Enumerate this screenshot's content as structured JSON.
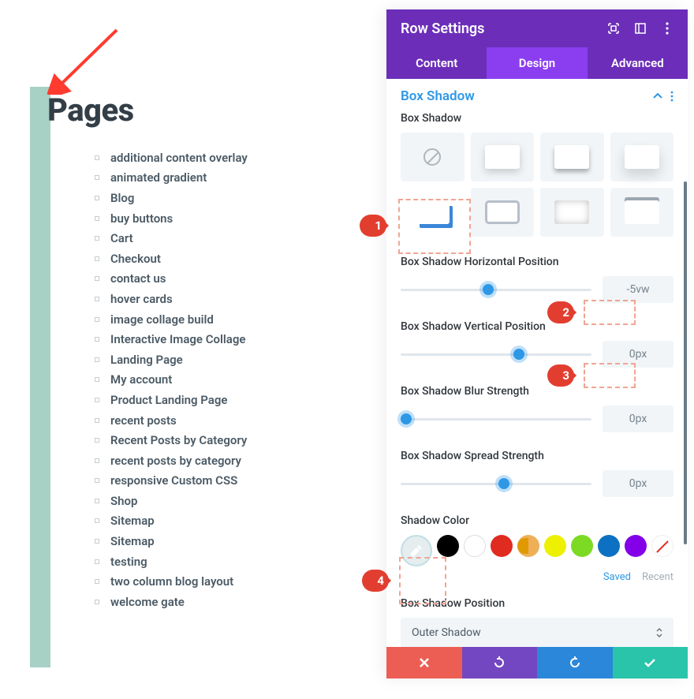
{
  "pages": {
    "heading": "Pages",
    "items": [
      "additional content overlay",
      "animated gradient",
      "Blog",
      "buy buttons",
      "Cart",
      "Checkout",
      "contact us",
      "hover cards",
      "image collage build",
      "Interactive Image Collage",
      "Landing Page",
      "My account",
      "Product Landing Page",
      "recent posts",
      "Recent Posts by Category",
      "recent posts by category",
      "responsive Custom CSS",
      "Shop",
      "Sitemap",
      "Sitemap",
      "testing",
      "two column blog layout",
      "welcome gate"
    ]
  },
  "panel": {
    "title": "Row Settings",
    "tabs": {
      "content": "Content",
      "design": "Design",
      "advanced": "Advanced"
    },
    "section": "Box Shadow",
    "subheading": "Box Shadow",
    "sliders": {
      "hpos": {
        "label": "Box Shadow Horizontal Position",
        "value": "-5vw",
        "pct": 46
      },
      "vpos": {
        "label": "Box Shadow Vertical Position",
        "value": "0px",
        "pct": 62
      },
      "blur": {
        "label": "Box Shadow Blur Strength",
        "value": "0px",
        "pct": 3
      },
      "spread": {
        "label": "Box Shadow Spread Strength",
        "value": "0px",
        "pct": 54
      }
    },
    "shadow_color_label": "Shadow Color",
    "color_tabs": {
      "saved": "Saved",
      "recent": "Recent"
    },
    "position": {
      "label": "Box Shadow Position",
      "value": "Outer Shadow"
    }
  },
  "callouts": {
    "c1": "1",
    "c2": "2",
    "c3": "3",
    "c4": "4"
  }
}
